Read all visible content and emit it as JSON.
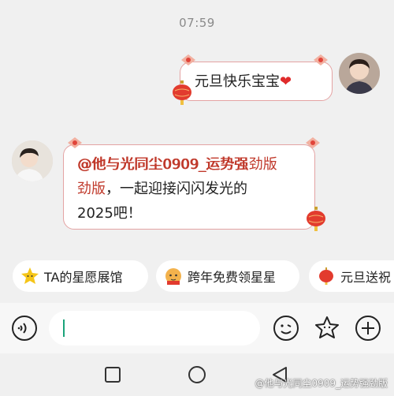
{
  "status": {
    "time": "07:59"
  },
  "messages": [
    {
      "side": "right",
      "text": "元旦快乐宝宝",
      "emoji": "❤"
    },
    {
      "side": "left",
      "mention": "@他与光同尘0909_运势强劲版",
      "text_line1_rest": "，一起迎接闪闪发光的",
      "text_line2": "2025吧！"
    }
  ],
  "chips": [
    {
      "icon": "star-face-icon",
      "label": "TA的星愿展馆"
    },
    {
      "icon": "tiger-cub-icon",
      "label": "跨年免费领星星"
    },
    {
      "icon": "lantern-icon",
      "label": "元旦送祝"
    }
  ],
  "input": {
    "placeholder": ""
  },
  "icons": {
    "voice": "voice-icon",
    "emoji": "emoji-icon",
    "sticker": "star-sticker-icon",
    "plus": "plus-icon",
    "nav_recents": "recents-square-icon",
    "nav_home": "home-circle-icon",
    "nav_back": "back-triangle-icon"
  },
  "watermark": "@他与光同尘0909_运势强劲版",
  "colors": {
    "bubble_border": "#e4a3a3",
    "mention": "#c0392b",
    "caret": "#1aa37a",
    "background": "#f0f0f0"
  }
}
